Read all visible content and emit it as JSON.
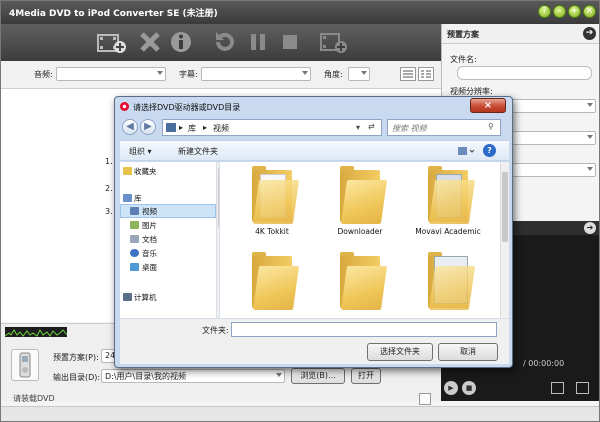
{
  "app": {
    "title": "4Media DVD to iPod Converter SE (未注册)",
    "window_buttons": [
      "help-icon",
      "minimize-icon",
      "maximize-icon",
      "close-icon"
    ]
  },
  "toolbar": {
    "icons": [
      "add-file-icon",
      "remove-icon",
      "info-icon",
      "convert-icon",
      "pause-icon",
      "stop-icon",
      "add-video-icon"
    ]
  },
  "options": {
    "audio_label": "音频:",
    "subtitle_label": "字幕:",
    "angle_label": "角度:"
  },
  "main": {
    "steps": [
      "1.",
      "2.",
      "3."
    ]
  },
  "right_panel": {
    "header": "预置方案",
    "filename_label": "文件名:",
    "resolution_label": "视频分辨率:"
  },
  "preview": {
    "time": "/ 00:00:00"
  },
  "bottom": {
    "preset_label": "预置方案(P):",
    "preset_value": "24",
    "output_label": "输出目录(D):",
    "output_value": "D:\\用户\\目录\\我的视频",
    "browse_label": "浏览(B)...",
    "open_label": "打开"
  },
  "status": {
    "text": "请装载DVD"
  },
  "dialog": {
    "title": "请选择DVD驱动器或DVD目录",
    "breadcrumb": [
      "库",
      "视频"
    ],
    "search_placeholder": "搜索 视频",
    "organize_label": "组织 ▾",
    "new_folder_label": "新建文件夹",
    "nav": {
      "favorites": "收藏夹",
      "library": "库",
      "videos": "视频",
      "pictures": "图片",
      "documents": "文档",
      "music": "音乐",
      "desktop": "桌面",
      "computer": "计算机"
    },
    "folders": [
      {
        "name": "4K Tokkit"
      },
      {
        "name": "Downloader"
      },
      {
        "name": "Movavi Academic"
      },
      {
        "name": ""
      },
      {
        "name": ""
      },
      {
        "name": ""
      }
    ],
    "folder_label": "文件夹:",
    "folder_value": "",
    "select_button": "选择文件夹",
    "cancel_button": "取消"
  },
  "colors": {
    "titlebar": "#3a3a3a",
    "accent_green": "#7fb21a",
    "dialog_frame": "#c9daf0",
    "close_red": "#c84a33"
  }
}
